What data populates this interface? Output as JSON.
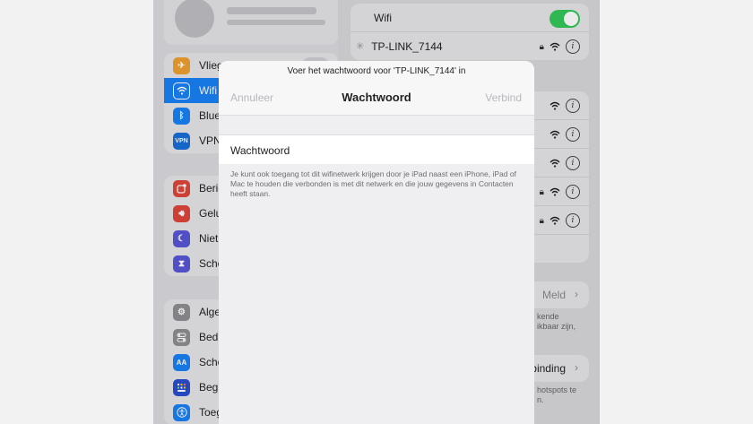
{
  "sidebar": {
    "items_group1": [
      {
        "label": "Vlieg",
        "icon": "airplane-icon",
        "color": "#f0a030"
      },
      {
        "label": "Wifi",
        "icon": "wifi-icon",
        "color": "#1a82f6",
        "active": true
      },
      {
        "label": "Blue",
        "icon": "bluetooth-icon",
        "color": "#1a82f6"
      },
      {
        "label": "VPN",
        "icon": "vpn-icon",
        "color": "#1a6ed8"
      }
    ],
    "items_group2": [
      {
        "label": "Berid",
        "icon": "notifications-icon",
        "color": "#e0453a"
      },
      {
        "label": "Gelu",
        "icon": "sound-icon",
        "color": "#e0453a"
      },
      {
        "label": "Niet",
        "icon": "moon-icon",
        "color": "#5856d6"
      },
      {
        "label": "Sche",
        "icon": "hourglass-icon",
        "color": "#5856d6"
      }
    ],
    "items_group3": [
      {
        "label": "Alge",
        "icon": "gear-icon",
        "color": "#8e8e93"
      },
      {
        "label": "Bedi",
        "icon": "control-center-icon",
        "color": "#8e8e93"
      },
      {
        "label": "Sche",
        "icon": "display-icon",
        "color": "#1a82f6"
      },
      {
        "label": "Begi",
        "icon": "home-screen-icon",
        "color": "#2a4fd0"
      },
      {
        "label": "Toeg",
        "icon": "accessibility-icon",
        "color": "#1a82f6"
      }
    ]
  },
  "detail": {
    "wifi_label": "Wifi",
    "connected_network": "TP-LINK_7144",
    "meld_label": "Meld",
    "verbinding_label": "rbinding",
    "note1_line1": "kende",
    "note1_line2": "ikbaar zijn,",
    "note2_line1": "hotspots te",
    "note2_line2": "n."
  },
  "modal": {
    "prompt": "Voer het wachtwoord voor 'TP-LINK_7144' in",
    "cancel_label": "Annuleer",
    "title": "Wachtwoord",
    "connect_label": "Verbind",
    "field_label": "Wachtwoord",
    "note": "Je kunt ook toegang tot dit wifinetwerk krijgen door je iPad naast een iPhone, iPad of Mac te houden die verbonden is met dit netwerk en die jouw gegevens in Contacten heeft staan."
  },
  "colors": {
    "accent": "#1a82f6",
    "toggle_on": "#34c759"
  }
}
